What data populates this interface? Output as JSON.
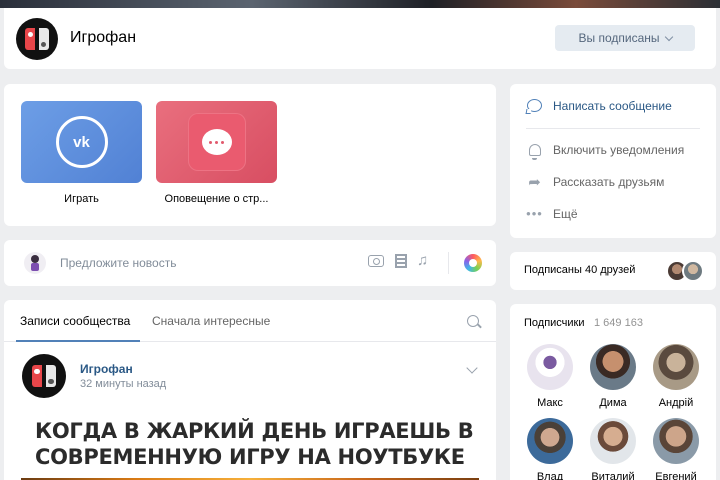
{
  "header": {
    "title": "Игрофан",
    "subscribed_label": "Вы подписаны"
  },
  "apps": [
    {
      "label": "Играть",
      "icon": "vk-logo-icon",
      "color": "#5b8ddc"
    },
    {
      "label": "Оповещение о стр...",
      "icon": "chat-bubble-icon",
      "color": "#e35d70"
    }
  ],
  "suggest": {
    "placeholder": "Предложите новость"
  },
  "wall": {
    "tabs": [
      "Записи сообщества",
      "Сначала интересные"
    ],
    "post": {
      "author": "Игрофан",
      "time": "32 минуты назад",
      "caption": "КОГДА В ЖАРКИЙ ДЕНЬ ИГРАЕШЬ В СОВРЕМЕННУЮ ИГРУ НА НОУТБУКЕ"
    }
  },
  "actions": [
    {
      "label": "Написать сообщение",
      "icon": "message-icon"
    },
    {
      "label": "Включить уведомления",
      "icon": "bell-icon"
    },
    {
      "label": "Рассказать друзьям",
      "icon": "share-icon"
    },
    {
      "label": "Ещё",
      "icon": "more-icon"
    }
  ],
  "friends": {
    "label": "Подписаны 40 друзей"
  },
  "subscribers": {
    "title": "Подписчики",
    "count": "1 649 163",
    "people": [
      "Макс",
      "Дима",
      "Андрій",
      "Влад",
      "Виталий",
      "Евгений"
    ]
  },
  "colors": {
    "accent": "#5181b8",
    "link": "#2a5885",
    "background": "#edeef0"
  }
}
